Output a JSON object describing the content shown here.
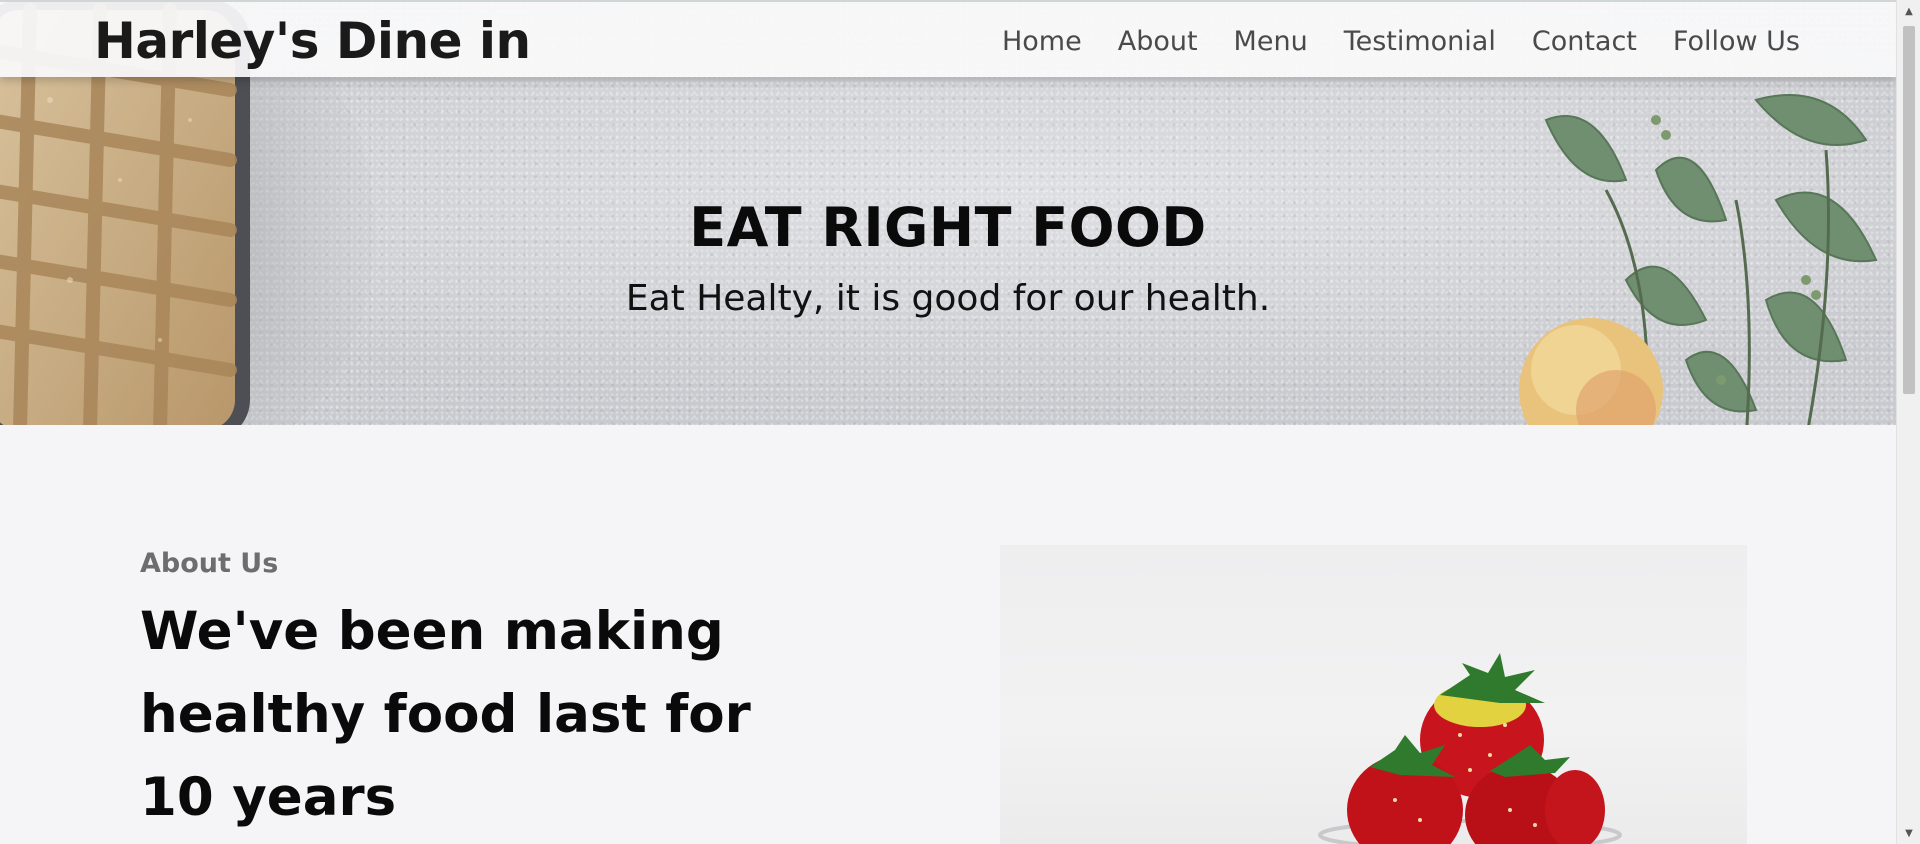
{
  "navbar": {
    "brand": "Harley's Dine in",
    "links": [
      "Home",
      "About",
      "Menu",
      "Testimonial",
      "Contact",
      "Follow Us"
    ]
  },
  "hero": {
    "title": "EAT RIGHT FOOD",
    "subtitle": "Eat Healty, it is good for our health."
  },
  "about": {
    "label": "About Us",
    "heading": "We've been making healthy food last for 10 years"
  },
  "icons": {
    "scroll_up": "scroll-up-arrow-icon",
    "scroll_down": "scroll-down-arrow-icon"
  },
  "colors": {
    "page_background": "#f5f5f7",
    "nav_link": "#4a4a4a",
    "about_label": "#6d6d6d",
    "heading": "#0a0a0a"
  }
}
